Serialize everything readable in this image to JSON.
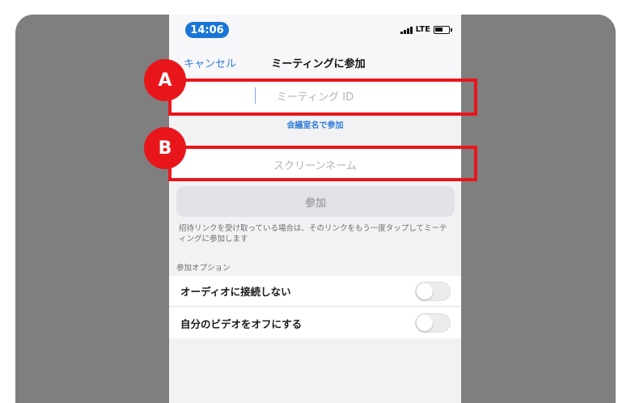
{
  "status_bar": {
    "time": "14:06",
    "network": "LTE"
  },
  "nav": {
    "cancel_label": "キャンセル",
    "title": "ミーティングに参加"
  },
  "meeting_id_field": {
    "placeholder": "ミーティング ID"
  },
  "join_by_room_link": "会議室名で参加",
  "screen_name_field": {
    "placeholder": "スクリーンネーム"
  },
  "join_button_label": "参加",
  "hint_text": "招待リンクを受け取っている場合は、そのリンクをもう一度タップしてミーティングに参加します",
  "options": {
    "header": "参加オプション",
    "items": [
      {
        "label": "オーディオに接続しない",
        "enabled": false
      },
      {
        "label": "自分のビデオをオフにする",
        "enabled": false
      }
    ]
  },
  "annotations": {
    "badge_a": "A",
    "badge_b": "B",
    "highlight_color": "#e8161b"
  },
  "colors": {
    "accent": "#2f7bd8",
    "time_pill": "#1976d6"
  }
}
